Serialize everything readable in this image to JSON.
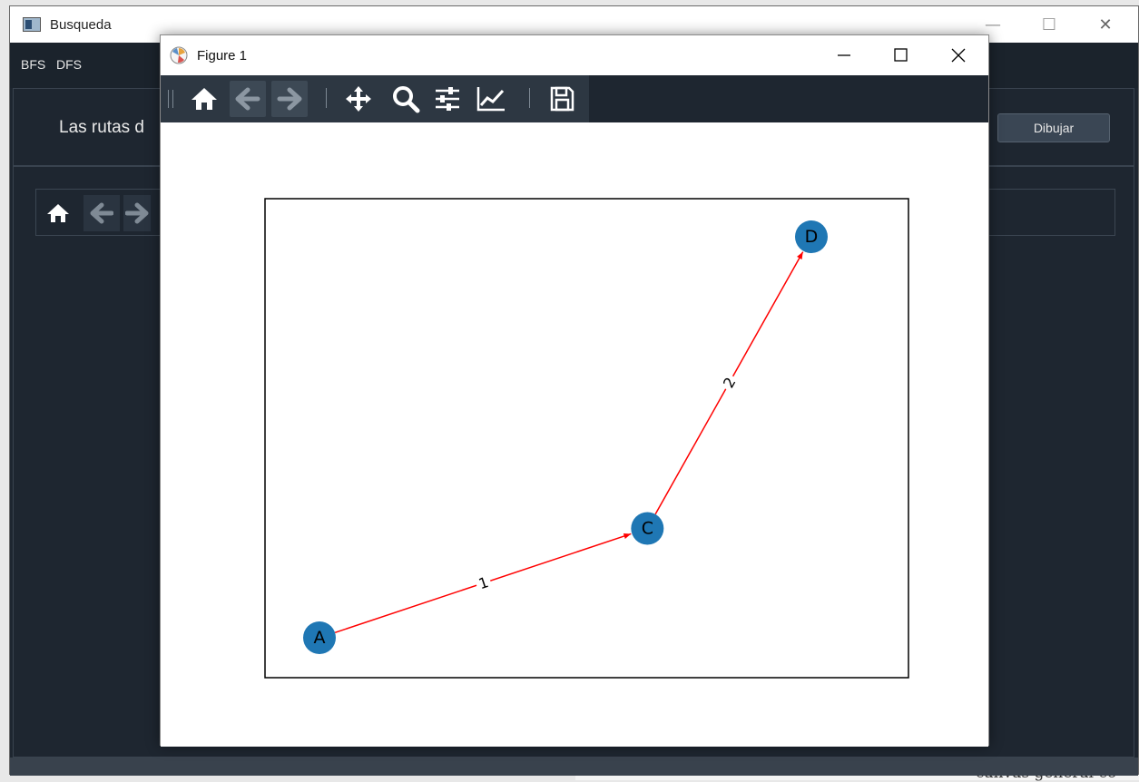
{
  "background": {
    "doc_text": "canvas general co"
  },
  "main_window": {
    "title": "Busqueda",
    "controls": {
      "minimize": "—",
      "maximize": "☐",
      "close": "✕"
    },
    "menu": [
      "BFS",
      "DFS"
    ],
    "route_label": "Las rutas d",
    "draw_button": "Dibujar"
  },
  "figure_window": {
    "title": "Figure 1",
    "toolbar": [
      "home-icon",
      "back-icon",
      "forward-icon",
      "pan-icon",
      "zoom-icon",
      "configure-subplots-icon",
      "edit-axis-icon",
      "save-icon"
    ]
  },
  "chart_data": {
    "type": "graph",
    "directed": true,
    "nodes": [
      {
        "id": "A",
        "x": 0,
        "y": 0
      },
      {
        "id": "C",
        "x": 1,
        "y": 0.3
      },
      {
        "id": "D",
        "x": 1.5,
        "y": 1.1
      }
    ],
    "edges": [
      {
        "from": "A",
        "to": "C",
        "label": "1"
      },
      {
        "from": "C",
        "to": "D",
        "label": "2"
      }
    ],
    "node_color": "#1f77b4",
    "edge_color": "#ff0000",
    "axes_frame": true
  }
}
